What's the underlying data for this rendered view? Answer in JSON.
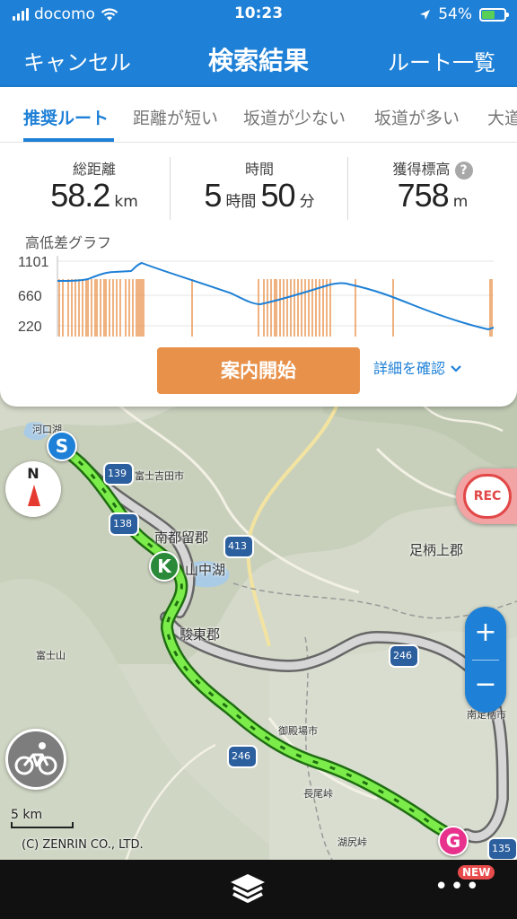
{
  "status_bar": {
    "carrier": "docomo",
    "time": "10:23",
    "battery": "54%",
    "icons": [
      "signal-icon",
      "wifi-icon",
      "location-arrow-icon",
      "battery-icon"
    ]
  },
  "nav": {
    "cancel_label": "キャンセル",
    "title": "検索結果",
    "route_list_label": "ルート一覧"
  },
  "tabs": [
    {
      "label": "推奨ルート",
      "active": true
    },
    {
      "label": "距離が短い",
      "active": false
    },
    {
      "label": "坂道が少ない",
      "active": false
    },
    {
      "label": "坂道が多い",
      "active": false
    },
    {
      "label": "大道",
      "active": false
    }
  ],
  "stats": {
    "distance": {
      "label": "総距離",
      "value": "58.2",
      "unit": "km"
    },
    "time": {
      "label": "時間",
      "hours": "5",
      "hours_unit": "時間",
      "minutes": "50",
      "minutes_unit": "分"
    },
    "elevation": {
      "label": "獲得標高",
      "value": "758",
      "unit": "m"
    }
  },
  "elevation_graph": {
    "label": "高低差グラフ",
    "y_ticks": [
      "1101",
      "660",
      "220"
    ],
    "accent_color": "#1e80d6",
    "slope_color": "#e8914a"
  },
  "actions": {
    "start_label": "案内開始",
    "detail_label": "詳細を確認"
  },
  "map": {
    "labels": {
      "fujiyoshida": "富士吉田市",
      "minamitsuru": "南都留郡",
      "yamanakako": "山中湖",
      "sunto": "駿東郡",
      "ashigarakami": "足柄上郡",
      "gotemba": "御殿場市",
      "fujisan": "富士山",
      "nagaoka": "長尾峠",
      "minamiashigara": "南足柄市",
      "kojiri": "湖尻峠",
      "kawaguchiko": "河口湖"
    },
    "road_numbers": [
      "139",
      "138",
      "413",
      "246",
      "246",
      "135"
    ],
    "markers": {
      "start": "S",
      "checkpoint": "K",
      "goal": "G"
    },
    "rec_label": "REC",
    "compass_label": "N",
    "zoom_in": "+",
    "zoom_out": "−",
    "scale_label": "5 km",
    "credit": "(C) ZENRIN CO., LTD."
  },
  "bottom": {
    "more_label": "•••",
    "new_badge": "NEW"
  }
}
